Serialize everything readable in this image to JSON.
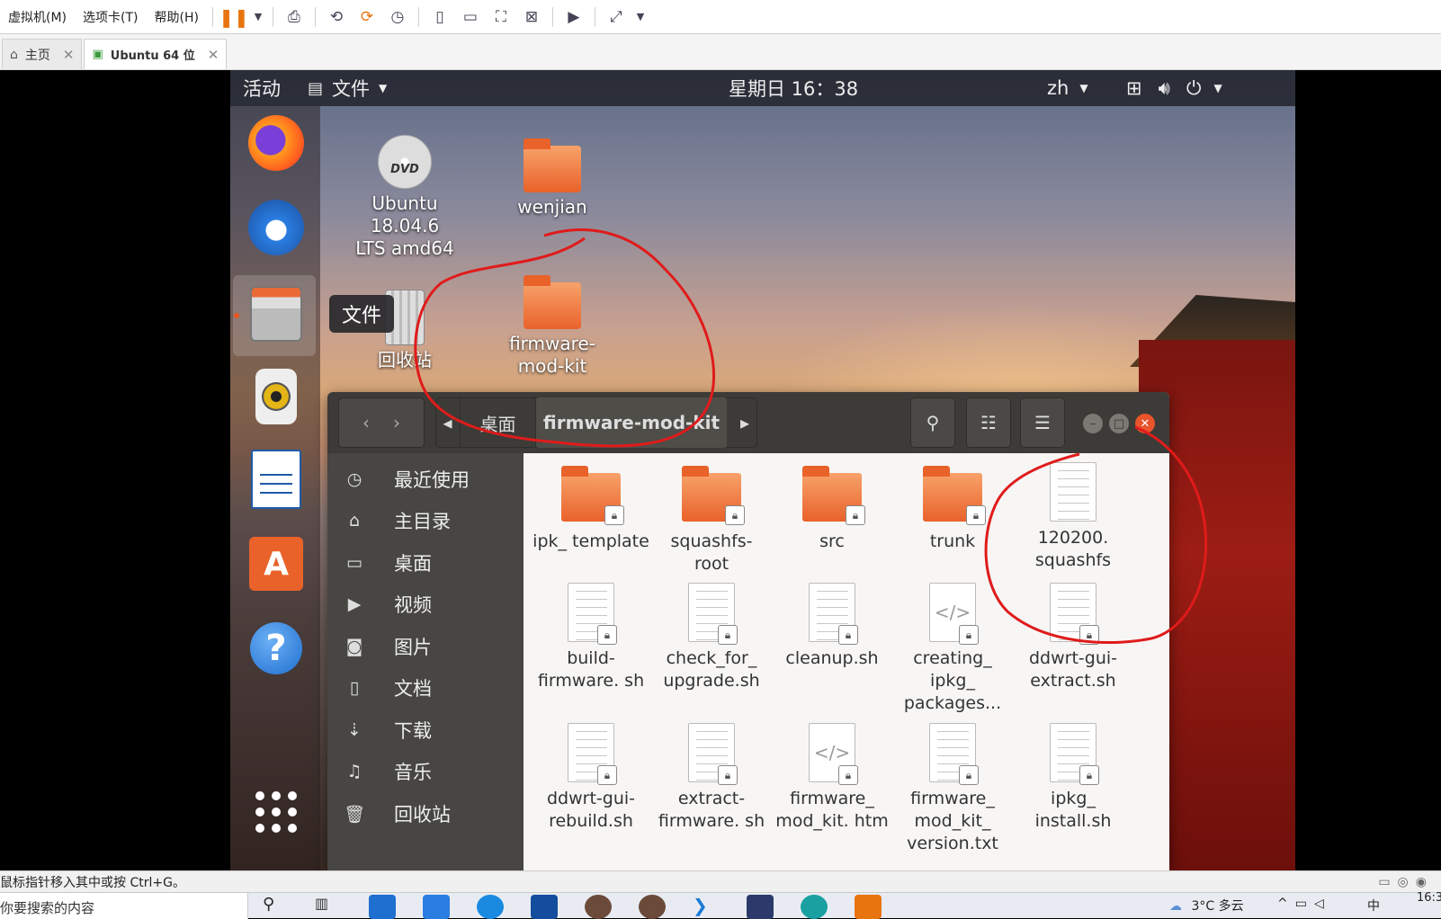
{
  "vm": {
    "menu": [
      "虚拟机(M)",
      "选项卡(T)",
      "帮助(H)"
    ],
    "tabs": [
      {
        "label": "主页",
        "icon": "home-icon"
      },
      {
        "label": "Ubuntu 64 位",
        "icon": "vm-icon"
      }
    ],
    "status_text": "鼠标指针移入其中或按 Ctrl+G。"
  },
  "ubuntu": {
    "activities": "活动",
    "app_menu": "文件",
    "clock": "星期日 16：38",
    "lang": "zh",
    "dock_tooltip": "文件",
    "desktop_icons": [
      {
        "label": "Ubuntu 18.04.6 LTS amd64",
        "icon": "dvd-icon"
      },
      {
        "label": "wenjian",
        "icon": "folder-icon"
      },
      {
        "label": "firmware-mod-kit",
        "icon": "folder-icon"
      },
      {
        "label": "回收站",
        "icon": "trash-icon"
      }
    ]
  },
  "nautilus": {
    "breadcrumb": [
      "桌面",
      "firmware-mod-kit"
    ],
    "sidebar": [
      {
        "label": "最近使用",
        "icon": "clock-icon"
      },
      {
        "label": "主目录",
        "icon": "home-icon"
      },
      {
        "label": "桌面",
        "icon": "folder-icon"
      },
      {
        "label": "视频",
        "icon": "video-icon"
      },
      {
        "label": "图片",
        "icon": "camera-icon"
      },
      {
        "label": "文档",
        "icon": "document-icon"
      },
      {
        "label": "下载",
        "icon": "download-icon"
      },
      {
        "label": "音乐",
        "icon": "music-icon"
      },
      {
        "label": "回收站",
        "icon": "trash-icon"
      }
    ],
    "files": [
      {
        "name": "ipk_ template",
        "type": "folder"
      },
      {
        "name": "squashfs- root",
        "type": "folder"
      },
      {
        "name": "src",
        "type": "folder"
      },
      {
        "name": "trunk",
        "type": "folder"
      },
      {
        "name": "120200. squashfs",
        "type": "file"
      },
      {
        "name": "build- firmware. sh",
        "type": "script"
      },
      {
        "name": "check_for_ upgrade.sh",
        "type": "script"
      },
      {
        "name": "cleanup.sh",
        "type": "script"
      },
      {
        "name": "creating_ ipkg_ packages...",
        "type": "code"
      },
      {
        "name": "ddwrt-gui- extract.sh",
        "type": "script"
      },
      {
        "name": "ddwrt-gui- rebuild.sh",
        "type": "script"
      },
      {
        "name": "extract- firmware. sh",
        "type": "script"
      },
      {
        "name": "firmware_ mod_kit. htm",
        "type": "code"
      },
      {
        "name": "firmware_ mod_kit_ version.txt",
        "type": "text"
      },
      {
        "name": "ipkg_ install.sh",
        "type": "script"
      }
    ]
  },
  "windows_taskbar": {
    "search_placeholder": "你要搜索的内容",
    "weather": "3°C 多云",
    "ime": "中",
    "time": "16:3"
  }
}
